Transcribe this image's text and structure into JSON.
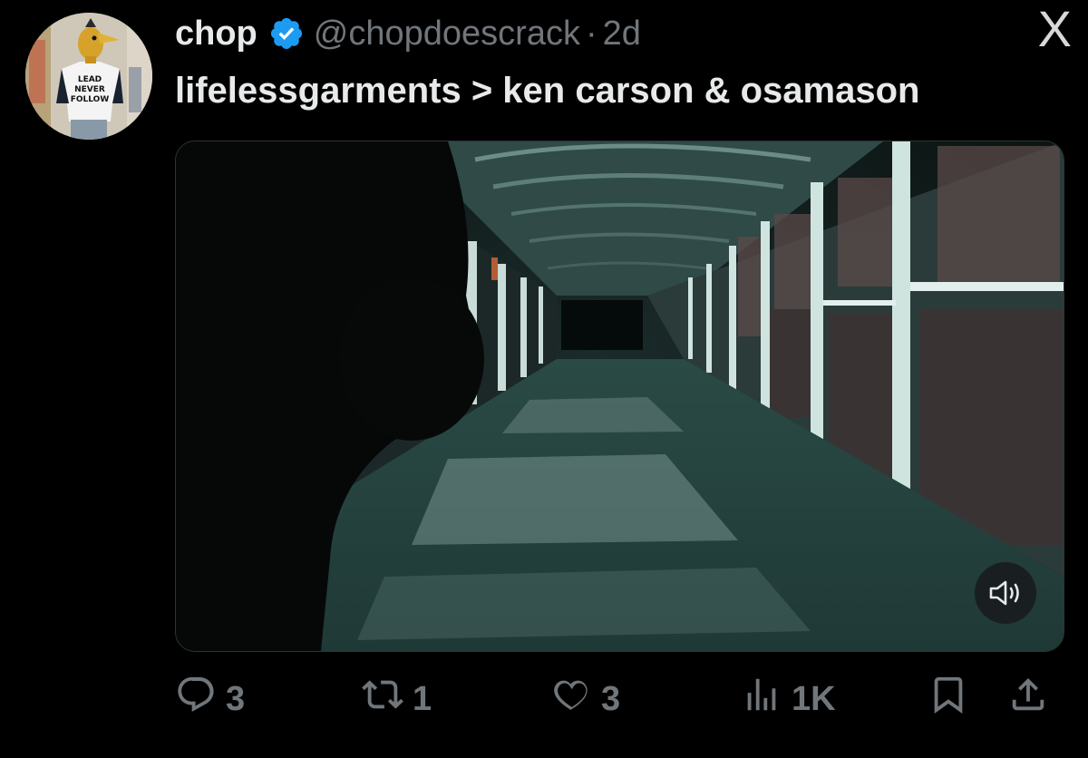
{
  "author": {
    "display_name": "chop",
    "handle": "@chopdoescrack",
    "separator": "·",
    "time_ago": "2d",
    "avatar_icon": "profile-avatar",
    "avatar_shirt_text": [
      "LEAD",
      "NEVER",
      "FOLLOW"
    ]
  },
  "brand": {
    "logo_icon": "x-logo",
    "logo_text": "X"
  },
  "tweet": {
    "text": "lifelessgarments > ken carson & osamason"
  },
  "media": {
    "type": "video",
    "mute_icon": "volume-icon"
  },
  "actions": {
    "reply": {
      "icon": "reply-icon",
      "count": "3"
    },
    "retweet": {
      "icon": "retweet-icon",
      "count": "1"
    },
    "like": {
      "icon": "heart-icon",
      "count": "3"
    },
    "views": {
      "icon": "views-icon",
      "count": "1K"
    },
    "bookmark": {
      "icon": "bookmark-icon"
    },
    "share": {
      "icon": "share-icon"
    }
  },
  "colors": {
    "background": "#000000",
    "text_primary": "#e7e9ea",
    "text_secondary": "#71767b",
    "verified_blue": "#1d9bf0"
  }
}
